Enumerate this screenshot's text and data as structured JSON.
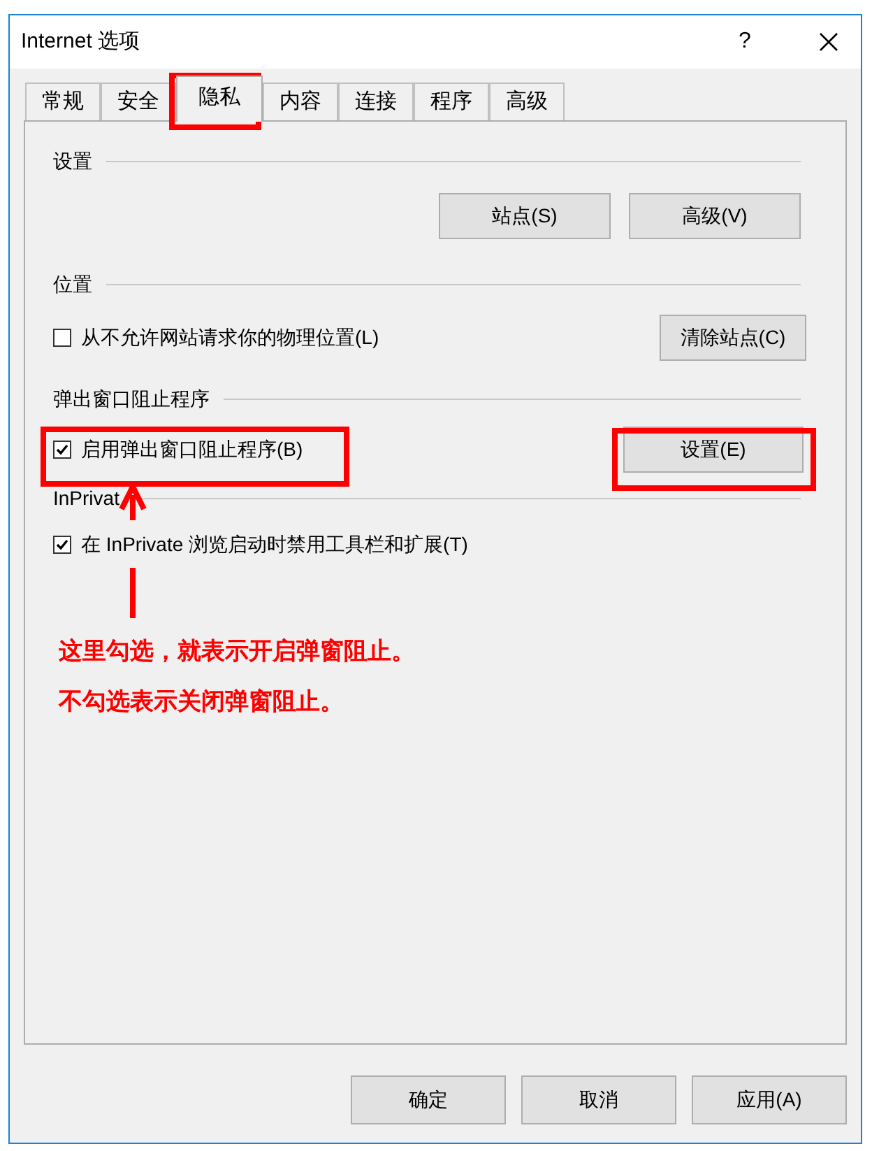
{
  "window": {
    "title": "Internet 选项",
    "help": "?"
  },
  "tabs": [
    {
      "label": "常规",
      "selected": false
    },
    {
      "label": "安全",
      "selected": false
    },
    {
      "label": "隐私",
      "selected": true
    },
    {
      "label": "内容",
      "selected": false
    },
    {
      "label": "连接",
      "selected": false
    },
    {
      "label": "程序",
      "selected": false
    },
    {
      "label": "高级",
      "selected": false
    }
  ],
  "settings": {
    "heading": "设置",
    "buttons": [
      "站点(S)",
      "高级(V)"
    ]
  },
  "location": {
    "heading": "位置",
    "checkbox": {
      "label": "从不允许网站请求你的物理位置(L)",
      "checked": false
    },
    "button": "清除站点(C)"
  },
  "popup_blocker": {
    "heading": "弹出窗口阻止程序",
    "checkbox": {
      "label": "启用弹出窗口阻止程序(B)",
      "checked": true
    },
    "button": "设置(E)"
  },
  "inprivate": {
    "heading": "InPrivat",
    "checkbox": {
      "label": "在 InPrivate 浏览启动时禁用工具栏和扩展(T)",
      "checked": true
    }
  },
  "annotation": {
    "lines": [
      "这里勾选，就表示开启弹窗阻止。",
      "不勾选表示关闭弹窗阻止。"
    ]
  },
  "buttons": [
    "确定",
    "取消",
    "应用(A)"
  ]
}
